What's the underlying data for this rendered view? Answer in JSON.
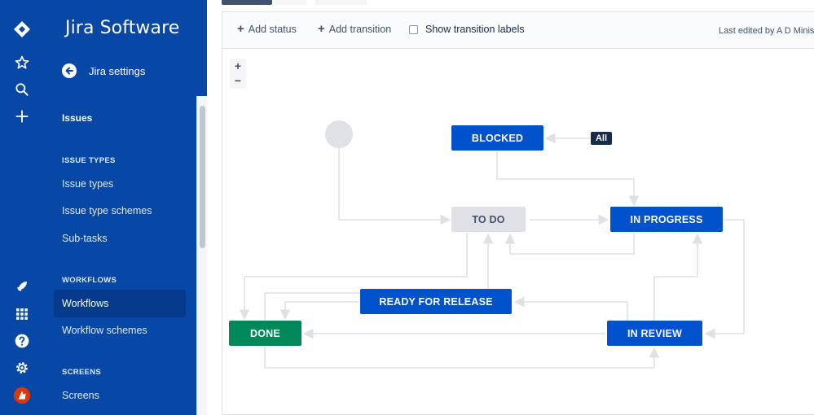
{
  "sidebar": {
    "title": "Jira Software",
    "back_label": "Jira settings",
    "section": "Issues",
    "categories": {
      "issue_types": "ISSUE TYPES",
      "workflows": "WORKFLOWS",
      "screens": "SCREENS"
    },
    "items": {
      "issue_types": "Issue types",
      "issue_type_schemes": "Issue type schemes",
      "sub_tasks": "Sub-tasks",
      "workflows": "Workflows",
      "workflow_schemes": "Workflow schemes",
      "screens": "Screens"
    }
  },
  "toolbar": {
    "add_status": "Add status",
    "add_transition": "Add transition",
    "show_transition_labels": "Show transition labels",
    "last_edited": "Last edited by A D Minis"
  },
  "zoom": {
    "in": "+",
    "out": "−"
  },
  "workflow": {
    "statuses": {
      "blocked": "BLOCKED",
      "todo": "TO DO",
      "in_progress": "IN PROGRESS",
      "ready_for_release": "READY FOR RELEASE",
      "done": "DONE",
      "in_review": "IN REVIEW"
    },
    "all_label": "All"
  },
  "colors": {
    "nav": "#0747a6",
    "status_blue": "#0052cc",
    "status_grey": "#dfe1e6",
    "status_green": "#00875a",
    "connector": "#dfe1e6"
  }
}
